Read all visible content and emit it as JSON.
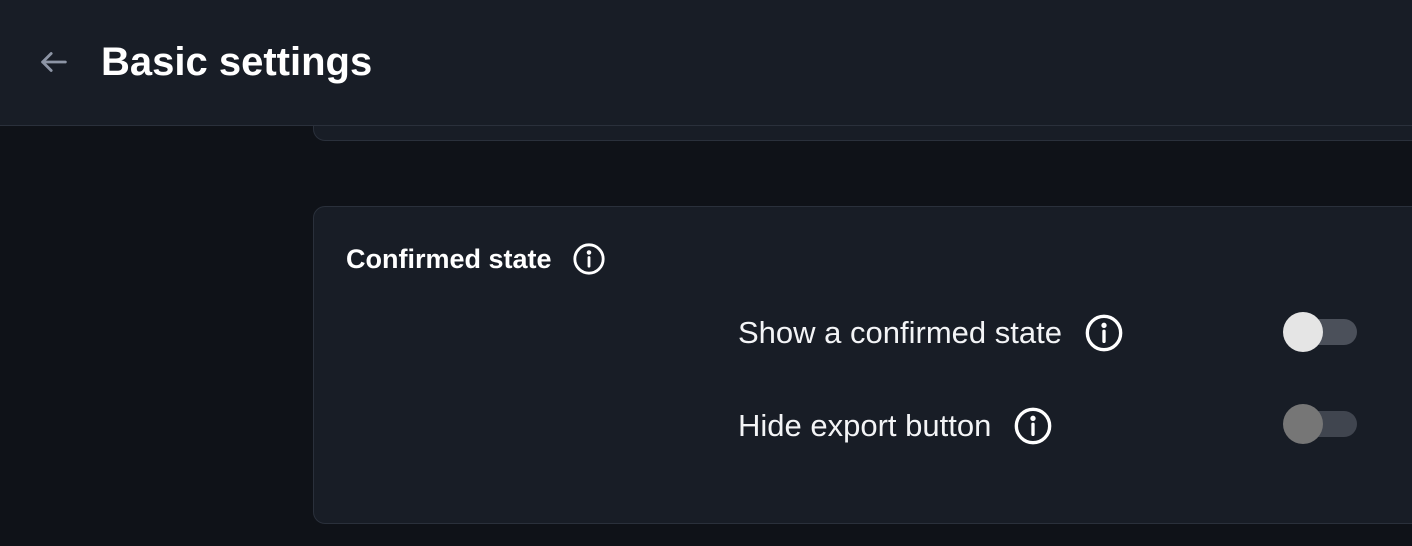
{
  "header": {
    "back_icon": "arrow-left-icon",
    "title": "Basic settings"
  },
  "card": {
    "title": "Confirmed state",
    "title_info_icon": "info-icon",
    "settings": [
      {
        "label": "Show a confirmed state",
        "info_icon": "info-icon",
        "toggle_on": false,
        "toggle_disabled": false
      },
      {
        "label": "Hide export button",
        "info_icon": "info-icon",
        "toggle_on": false,
        "toggle_disabled": true
      }
    ]
  },
  "colors": {
    "page_background": "#0f1218",
    "panel_background": "#181d26",
    "border": "#2a303b",
    "text": "#f3f4f6",
    "toggle_track": "#4b505a",
    "toggle_knob": "#e5e5e5",
    "toggle_knob_disabled": "#767676"
  }
}
